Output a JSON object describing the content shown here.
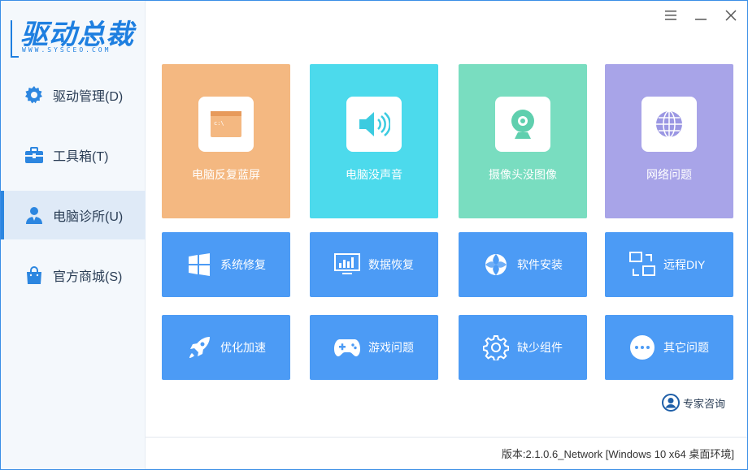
{
  "app": {
    "logo_text": "驱动总裁",
    "logo_sub": "WWW.SYSCEO.COM"
  },
  "sidebar": {
    "items": [
      {
        "label": "驱动管理(D)",
        "icon": "gear-icon",
        "active": false
      },
      {
        "label": "工具箱(T)",
        "icon": "toolbox-icon",
        "active": false
      },
      {
        "label": "电脑诊所(U)",
        "icon": "doctor-icon",
        "active": true
      },
      {
        "label": "官方商城(S)",
        "icon": "shopping-bag-icon",
        "active": false
      }
    ]
  },
  "window_controls": {
    "menu": "menu-icon",
    "minimize": "minimize-icon",
    "close": "close-icon"
  },
  "tiles_large": [
    {
      "label": "电脑反复蓝屏",
      "icon": "terminal-window-icon",
      "color": "#f4b881"
    },
    {
      "label": "电脑没声音",
      "icon": "speaker-icon",
      "color": "#4cdaec"
    },
    {
      "label": "摄像头没图像",
      "icon": "webcam-icon",
      "color": "#79ddc0"
    },
    {
      "label": "网络问题",
      "icon": "globe-icon",
      "color": "#a8a4e8"
    }
  ],
  "tiles_small": [
    {
      "label": "系统修复",
      "icon": "windows-icon"
    },
    {
      "label": "数据恢复",
      "icon": "monitor-chart-icon"
    },
    {
      "label": "软件安装",
      "icon": "aperture-icon"
    },
    {
      "label": "远程DIY",
      "icon": "remote-screens-icon"
    },
    {
      "label": "优化加速",
      "icon": "rocket-icon"
    },
    {
      "label": "游戏问题",
      "icon": "gamepad-icon"
    },
    {
      "label": "缺少组件",
      "icon": "cog-icon"
    },
    {
      "label": "其它问题",
      "icon": "more-dots-icon"
    }
  ],
  "colors": {
    "small_tile": "#4c9bf5",
    "accent": "#2c86e0"
  },
  "consult": {
    "label": "专家咨询",
    "icon": "user-circle-icon"
  },
  "footer": {
    "version": "版本:2.1.0.6_Network [Windows 10 x64 桌面环境]"
  }
}
